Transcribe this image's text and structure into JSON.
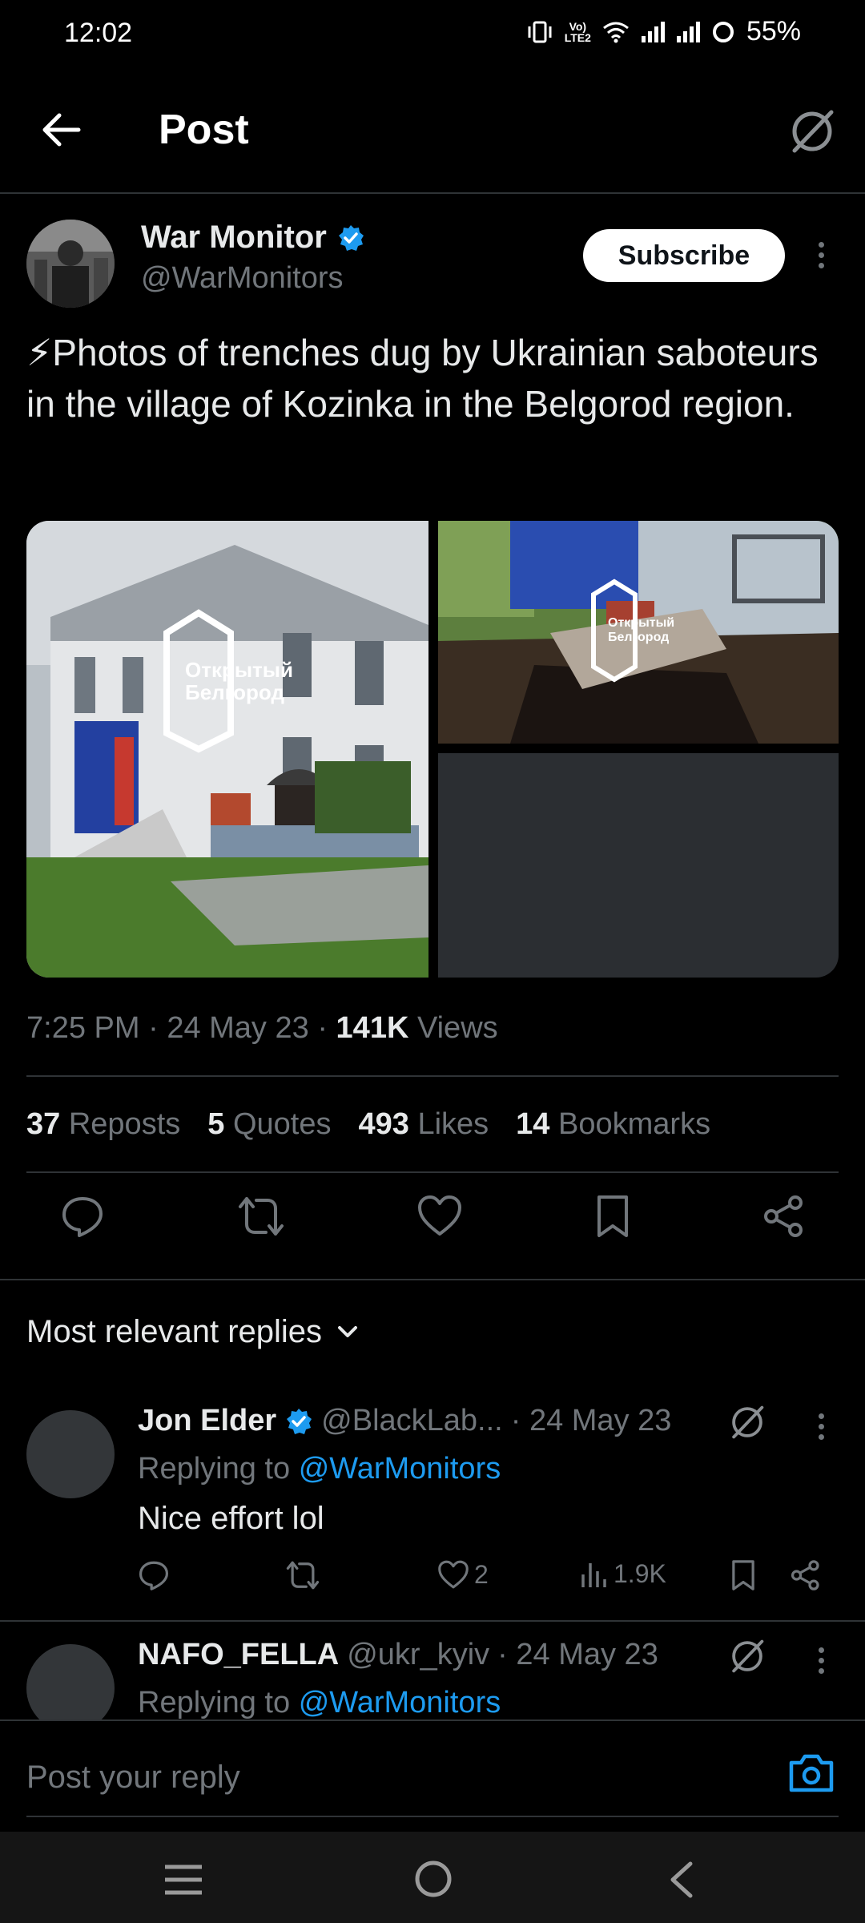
{
  "status": {
    "time": "12:02",
    "battery": "55%",
    "network": "LTE2"
  },
  "header": {
    "title": "Post"
  },
  "post": {
    "author_name": "War Monitor",
    "author_handle": "@WarMonitors",
    "subscribe_label": "Subscribe",
    "text": "⚡Photos of trenches dug by Ukrainian saboteurs in the village of Kozinka in the Belgorod region.",
    "watermark_line1": "Открытый",
    "watermark_line2": "Белгород",
    "time": "7:25 PM",
    "date": "24 May 23",
    "views_count": "141K",
    "views_label": "Views",
    "stats": {
      "reposts_count": "37",
      "reposts_label": "Reposts",
      "quotes_count": "5",
      "quotes_label": "Quotes",
      "likes_count": "493",
      "likes_label": "Likes",
      "bookmarks_count": "14",
      "bookmarks_label": "Bookmarks"
    }
  },
  "replies_sort": {
    "label": "Most relevant replies"
  },
  "replies": [
    {
      "name": "Jon Elder",
      "handle": "@BlackLab...",
      "date": "· 24 May 23",
      "replying_prefix": "Replying to",
      "replying_to": "@WarMonitors",
      "text": "Nice effort lol",
      "likes": "2",
      "views": "1.9K"
    },
    {
      "name": "NAFO_FELLA",
      "handle": "@ukr_kyiv",
      "date": "· 24 May 23",
      "replying_prefix": "Replying to",
      "replying_to": "@WarMonitors"
    }
  ],
  "composer": {
    "placeholder": "Post your reply"
  },
  "colors": {
    "accent": "#1d9bf0",
    "background": "#000000",
    "muted": "#71767b"
  }
}
